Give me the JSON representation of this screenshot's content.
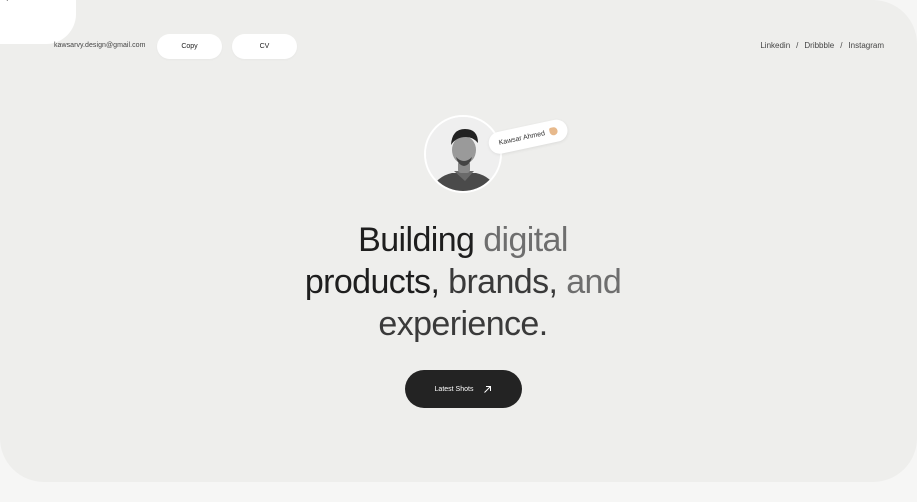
{
  "header": {
    "email": "kawsarvy.design@gmail.com",
    "copy_label": "Copy",
    "cv_label": "CV",
    "social": [
      {
        "label": "Linkedin"
      },
      {
        "label": "Dribbble"
      },
      {
        "label": "Instagram"
      }
    ],
    "separator": "/"
  },
  "profile": {
    "name_tag": "Kawsar Ahmed"
  },
  "hero": {
    "line1_a": "Building",
    "line1_b": " digital",
    "line2_a": "products,",
    "line2_b": " brands,",
    "line2_c": " and",
    "line3": "experience."
  },
  "cta": {
    "label": "Latest Shots",
    "icon": "arrow-up-right-icon"
  },
  "colors": {
    "background": "#eeeeec",
    "primary_text": "#1e1e1e",
    "muted_text": "#6e6e6e",
    "button_dark": "#232323",
    "pill_bg": "#ffffff"
  }
}
